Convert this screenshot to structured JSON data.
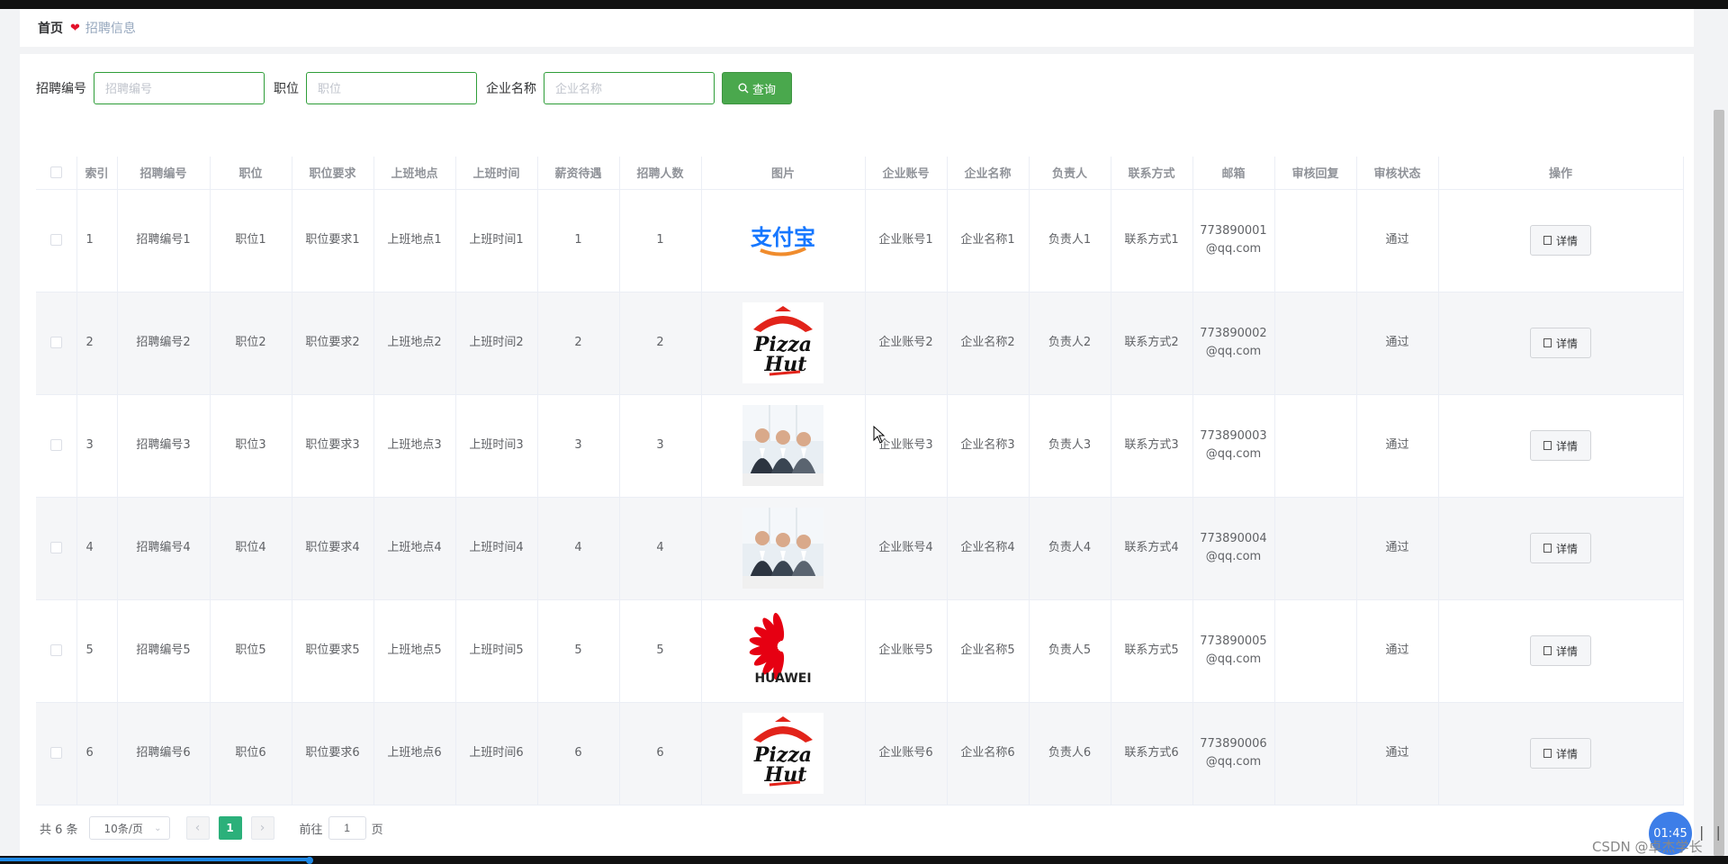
{
  "breadcrumb": {
    "home": "首页",
    "current": "招聘信息"
  },
  "search": {
    "fields": [
      {
        "label": "招聘编号",
        "placeholder": "招聘编号"
      },
      {
        "label": "职位",
        "placeholder": "职位"
      },
      {
        "label": "企业名称",
        "placeholder": "企业名称"
      }
    ],
    "button_label": "查询"
  },
  "table": {
    "headers": [
      "索引",
      "招聘编号",
      "职位",
      "职位要求",
      "上班地点",
      "上班时间",
      "薪资待遇",
      "招聘人数",
      "图片",
      "企业账号",
      "企业名称",
      "负责人",
      "联系方式",
      "邮箱",
      "审核回复",
      "审核状态",
      "操作"
    ],
    "detail_label": "详情",
    "rows": [
      {
        "index": "1",
        "code": "招聘编号1",
        "position": "职位1",
        "requirement": "职位要求1",
        "location": "上班地点1",
        "worktime": "上班时间1",
        "salary": "1",
        "count": "1",
        "image": "alipay-logo",
        "account": "企业账号1",
        "company": "企业名称1",
        "manager": "负责人1",
        "contact": "联系方式1",
        "email_1": "773890001",
        "email_2": "@qq.com",
        "reply": "",
        "status": "通过"
      },
      {
        "index": "2",
        "code": "招聘编号2",
        "position": "职位2",
        "requirement": "职位要求2",
        "location": "上班地点2",
        "worktime": "上班时间2",
        "salary": "2",
        "count": "2",
        "image": "pizzahut-logo",
        "account": "企业账号2",
        "company": "企业名称2",
        "manager": "负责人2",
        "contact": "联系方式2",
        "email_1": "773890002",
        "email_2": "@qq.com",
        "reply": "",
        "status": "通过"
      },
      {
        "index": "3",
        "code": "招聘编号3",
        "position": "职位3",
        "requirement": "职位要求3",
        "location": "上班地点3",
        "worktime": "上班时间3",
        "salary": "3",
        "count": "3",
        "image": "meeting-photo",
        "account": "企业账号3",
        "company": "企业名称3",
        "manager": "负责人3",
        "contact": "联系方式3",
        "email_1": "773890003",
        "email_2": "@qq.com",
        "reply": "",
        "status": "通过"
      },
      {
        "index": "4",
        "code": "招聘编号4",
        "position": "职位4",
        "requirement": "职位要求4",
        "location": "上班地点4",
        "worktime": "上班时间4",
        "salary": "4",
        "count": "4",
        "image": "meeting-photo",
        "account": "企业账号4",
        "company": "企业名称4",
        "manager": "负责人4",
        "contact": "联系方式4",
        "email_1": "773890004",
        "email_2": "@qq.com",
        "reply": "",
        "status": "通过"
      },
      {
        "index": "5",
        "code": "招聘编号5",
        "position": "职位5",
        "requirement": "职位要求5",
        "location": "上班地点5",
        "worktime": "上班时间5",
        "salary": "5",
        "count": "5",
        "image": "huawei-logo",
        "account": "企业账号5",
        "company": "企业名称5",
        "manager": "负责人5",
        "contact": "联系方式5",
        "email_1": "773890005",
        "email_2": "@qq.com",
        "reply": "",
        "status": "通过"
      },
      {
        "index": "6",
        "code": "招聘编号6",
        "position": "职位6",
        "requirement": "职位要求6",
        "location": "上班地点6",
        "worktime": "上班时间6",
        "salary": "6",
        "count": "6",
        "image": "pizzahut-logo",
        "account": "企业账号6",
        "company": "企业名称6",
        "manager": "负责人6",
        "contact": "联系方式6",
        "email_1": "773890006",
        "email_2": "@qq.com",
        "reply": "",
        "status": "通过"
      }
    ]
  },
  "pagination": {
    "total": "共 6 条",
    "page_size": "10条/页",
    "current_page": "1",
    "goto_label": "前往",
    "goto_value": "1",
    "page_unit": "页"
  },
  "overlay": {
    "timer": "01:45",
    "watermark": "CSDN @卓杰学长"
  },
  "colors": {
    "accent_green": "#4aa84d",
    "page_green": "#2bb07a",
    "heart": "#e3122b"
  }
}
